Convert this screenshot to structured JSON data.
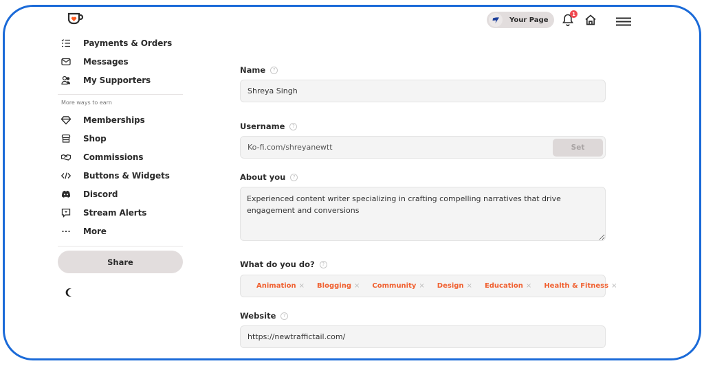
{
  "colors": {
    "frame": "#1a6ad8",
    "tag_text": "#f06030",
    "badge": "#f0484f",
    "logo_heart": "#ff5a1f"
  },
  "sidebar": {
    "logo": "ko-fi-cup-logo",
    "items": [
      {
        "label": "Payments & Orders",
        "icon": "checklist-icon"
      },
      {
        "label": "Messages",
        "icon": "envelope-icon"
      },
      {
        "label": "My Supporters",
        "icon": "users-icon"
      }
    ],
    "section_label": "More ways to earn",
    "earn_items": [
      {
        "label": "Memberships",
        "icon": "diamond-icon"
      },
      {
        "label": "Shop",
        "icon": "shop-icon"
      },
      {
        "label": "Commissions",
        "icon": "handshake-icon"
      },
      {
        "label": "Buttons & Widgets",
        "icon": "code-icon"
      },
      {
        "label": "Discord",
        "icon": "discord-icon"
      },
      {
        "label": "Stream Alerts",
        "icon": "stream-alert-icon"
      },
      {
        "label": "More",
        "icon": "ellipsis-icon"
      }
    ],
    "share_label": "Share",
    "theme_icon": "moon-icon"
  },
  "topbar": {
    "your_page_label": "Your Page",
    "notification_count": "1"
  },
  "form": {
    "name": {
      "label": "Name",
      "help": "?",
      "value": "Shreya Singh"
    },
    "username": {
      "label": "Username",
      "help": "?",
      "value": "Ko-fi.com/shreyanewtt",
      "button": "Set"
    },
    "about": {
      "label": "About you",
      "help": "?",
      "value": "Experienced content writer specializing in crafting compelling narratives that drive engagement and conversions"
    },
    "what": {
      "label": "What do you do?",
      "help": "?",
      "tags": [
        "Animation",
        "Blogging",
        "Community",
        "Design",
        "Education",
        "Health & Fitness"
      ],
      "remove": "×"
    },
    "website": {
      "label": "Website",
      "help": "?",
      "value": "https://newtraffictail.com/"
    }
  }
}
